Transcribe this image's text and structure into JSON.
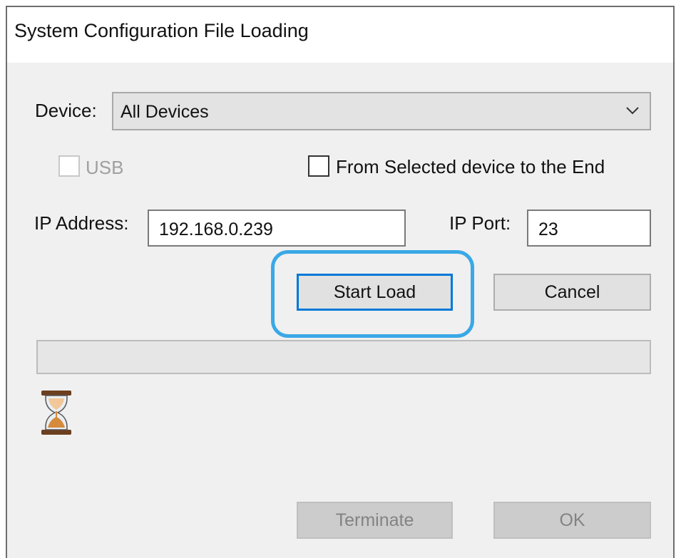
{
  "window": {
    "title": "System Configuration File Loading"
  },
  "device": {
    "label": "Device:",
    "selected": "All Devices"
  },
  "usb": {
    "label": "USB",
    "checked": false,
    "enabled": false
  },
  "from_selected": {
    "label": "From Selected device to the End",
    "checked": false
  },
  "ip_address": {
    "label": "IP Address:",
    "value": "192.168.0.239"
  },
  "ip_port": {
    "label": "IP Port:",
    "value": "23"
  },
  "buttons": {
    "start_load": "Start Load",
    "cancel": "Cancel",
    "terminate": "Terminate",
    "ok": "OK"
  },
  "progress": {
    "value": 0
  },
  "colors": {
    "highlight": "#3aa8e6",
    "default_button_border": "#0078d7",
    "dialog_background": "#f0f0f0"
  },
  "icons": {
    "dropdown": "chevron-down-icon",
    "busy": "hourglass-icon"
  }
}
